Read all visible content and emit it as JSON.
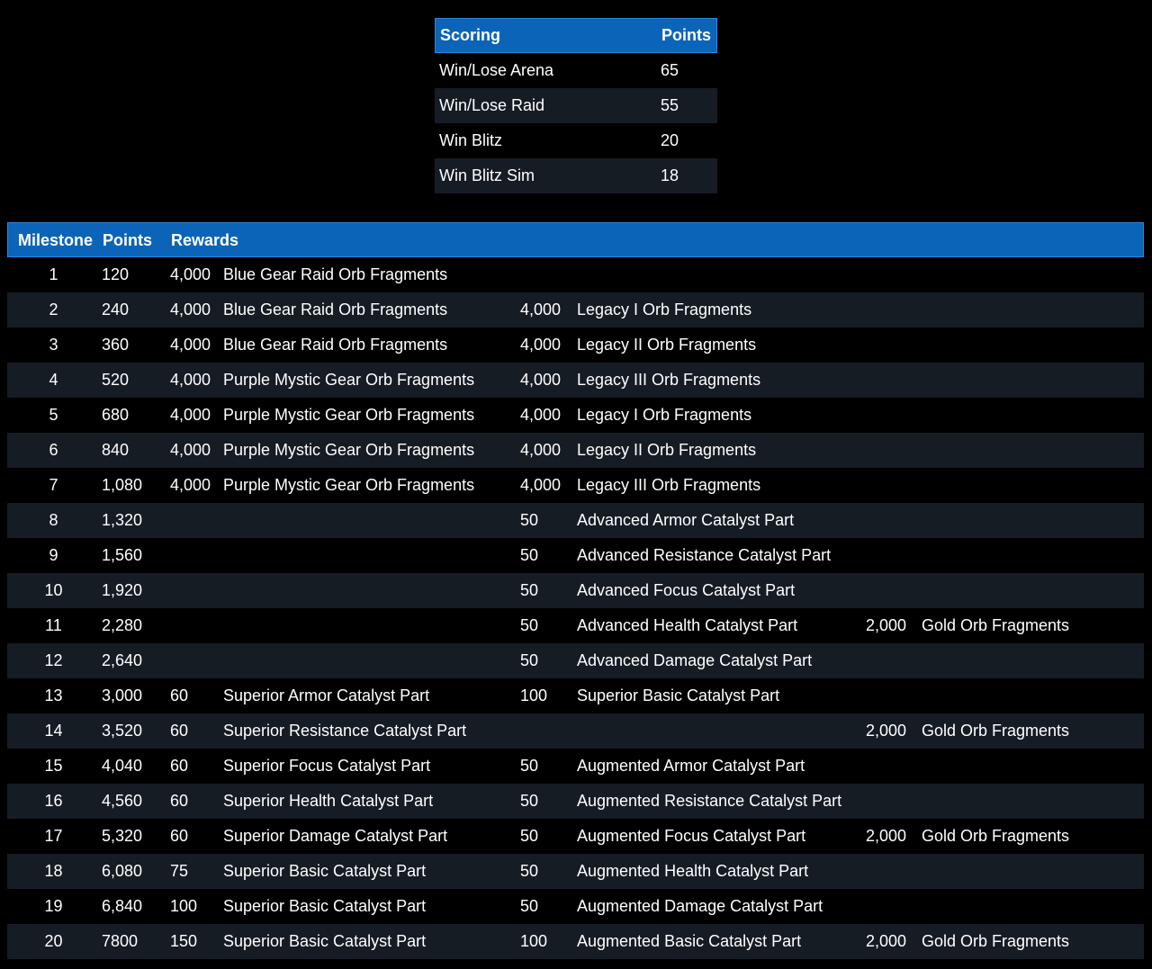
{
  "scoring": {
    "headers": {
      "activity": "Scoring",
      "points": "Points"
    },
    "rows": [
      {
        "activity": "Win/Lose Arena",
        "points": "65"
      },
      {
        "activity": "Win/Lose Raid",
        "points": "55"
      },
      {
        "activity": "Win Blitz",
        "points": "20"
      },
      {
        "activity": "Win Blitz Sim",
        "points": "18"
      }
    ]
  },
  "milestones": {
    "headers": {
      "milestone": "Milestone",
      "points": "Points",
      "rewards": "Rewards"
    },
    "rows": [
      {
        "ms": "1",
        "pts": "120",
        "q1": "4,000",
        "n1": "Blue Gear Raid Orb Fragments",
        "q2": "",
        "n2": "",
        "q3": "",
        "n3": ""
      },
      {
        "ms": "2",
        "pts": "240",
        "q1": "4,000",
        "n1": "Blue Gear Raid Orb Fragments",
        "q2": "4,000",
        "n2": "Legacy I Orb Fragments",
        "q3": "",
        "n3": ""
      },
      {
        "ms": "3",
        "pts": "360",
        "q1": "4,000",
        "n1": "Blue Gear Raid Orb Fragments",
        "q2": "4,000",
        "n2": "Legacy II Orb Fragments",
        "q3": "",
        "n3": ""
      },
      {
        "ms": "4",
        "pts": "520",
        "q1": "4,000",
        "n1": "Purple Mystic Gear Orb Fragments",
        "q2": "4,000",
        "n2": "Legacy III Orb Fragments",
        "q3": "",
        "n3": ""
      },
      {
        "ms": "5",
        "pts": "680",
        "q1": "4,000",
        "n1": "Purple Mystic Gear Orb Fragments",
        "q2": "4,000",
        "n2": "Legacy I Orb Fragments",
        "q3": "",
        "n3": ""
      },
      {
        "ms": "6",
        "pts": "840",
        "q1": "4,000",
        "n1": "Purple Mystic Gear Orb Fragments",
        "q2": "4,000",
        "n2": "Legacy II Orb Fragments",
        "q3": "",
        "n3": ""
      },
      {
        "ms": "7",
        "pts": "1,080",
        "q1": "4,000",
        "n1": "Purple Mystic Gear Orb Fragments",
        "q2": "4,000",
        "n2": "Legacy III Orb Fragments",
        "q3": "",
        "n3": ""
      },
      {
        "ms": "8",
        "pts": "1,320",
        "q1": "",
        "n1": "",
        "q2": "50",
        "n2": "Advanced Armor Catalyst Part",
        "q3": "",
        "n3": ""
      },
      {
        "ms": "9",
        "pts": "1,560",
        "q1": "",
        "n1": "",
        "q2": "50",
        "n2": "Advanced Resistance Catalyst Part",
        "q3": "",
        "n3": ""
      },
      {
        "ms": "10",
        "pts": "1,920",
        "q1": "",
        "n1": "",
        "q2": "50",
        "n2": "Advanced Focus Catalyst Part",
        "q3": "",
        "n3": ""
      },
      {
        "ms": "11",
        "pts": "2,280",
        "q1": "",
        "n1": "",
        "q2": "50",
        "n2": "Advanced Health Catalyst Part",
        "q3": "2,000",
        "n3": "Gold Orb Fragments"
      },
      {
        "ms": "12",
        "pts": "2,640",
        "q1": "",
        "n1": "",
        "q2": "50",
        "n2": "Advanced Damage Catalyst Part",
        "q3": "",
        "n3": ""
      },
      {
        "ms": "13",
        "pts": "3,000",
        "q1": "60",
        "n1": "Superior Armor Catalyst Part",
        "q2": "100",
        "n2": "Superior Basic Catalyst Part",
        "q3": "",
        "n3": ""
      },
      {
        "ms": "14",
        "pts": "3,520",
        "q1": "60",
        "n1": "Superior Resistance Catalyst Part",
        "q2": "",
        "n2": "",
        "q3": "2,000",
        "n3": "Gold Orb Fragments"
      },
      {
        "ms": "15",
        "pts": "4,040",
        "q1": "60",
        "n1": "Superior Focus Catalyst Part",
        "q2": "50",
        "n2": "Augmented Armor Catalyst Part",
        "q3": "",
        "n3": ""
      },
      {
        "ms": "16",
        "pts": "4,560",
        "q1": "60",
        "n1": "Superior Health Catalyst Part",
        "q2": "50",
        "n2": "Augmented Resistance Catalyst Part",
        "q3": "",
        "n3": ""
      },
      {
        "ms": "17",
        "pts": "5,320",
        "q1": "60",
        "n1": "Superior Damage Catalyst Part",
        "q2": "50",
        "n2": "Augmented Focus Catalyst Part",
        "q3": "2,000",
        "n3": "Gold Orb Fragments"
      },
      {
        "ms": "18",
        "pts": "6,080",
        "q1": "75",
        "n1": "Superior Basic Catalyst Part",
        "q2": "50",
        "n2": "Augmented Health Catalyst Part",
        "q3": "",
        "n3": ""
      },
      {
        "ms": "19",
        "pts": "6,840",
        "q1": "100",
        "n1": "Superior Basic Catalyst Part",
        "q2": "50",
        "n2": "Augmented Damage Catalyst Part",
        "q3": "",
        "n3": ""
      },
      {
        "ms": "20",
        "pts": "7800",
        "q1": "150",
        "n1": "Superior Basic Catalyst Part",
        "q2": "100",
        "n2": "Augmented Basic Catalyst Part",
        "q3": "2,000",
        "n3": "Gold Orb Fragments"
      }
    ]
  },
  "colors": {
    "header_bg": "#0c64b9",
    "row_alt_bg": "#161c24",
    "page_bg": "#000000",
    "text": "#ffffff"
  }
}
